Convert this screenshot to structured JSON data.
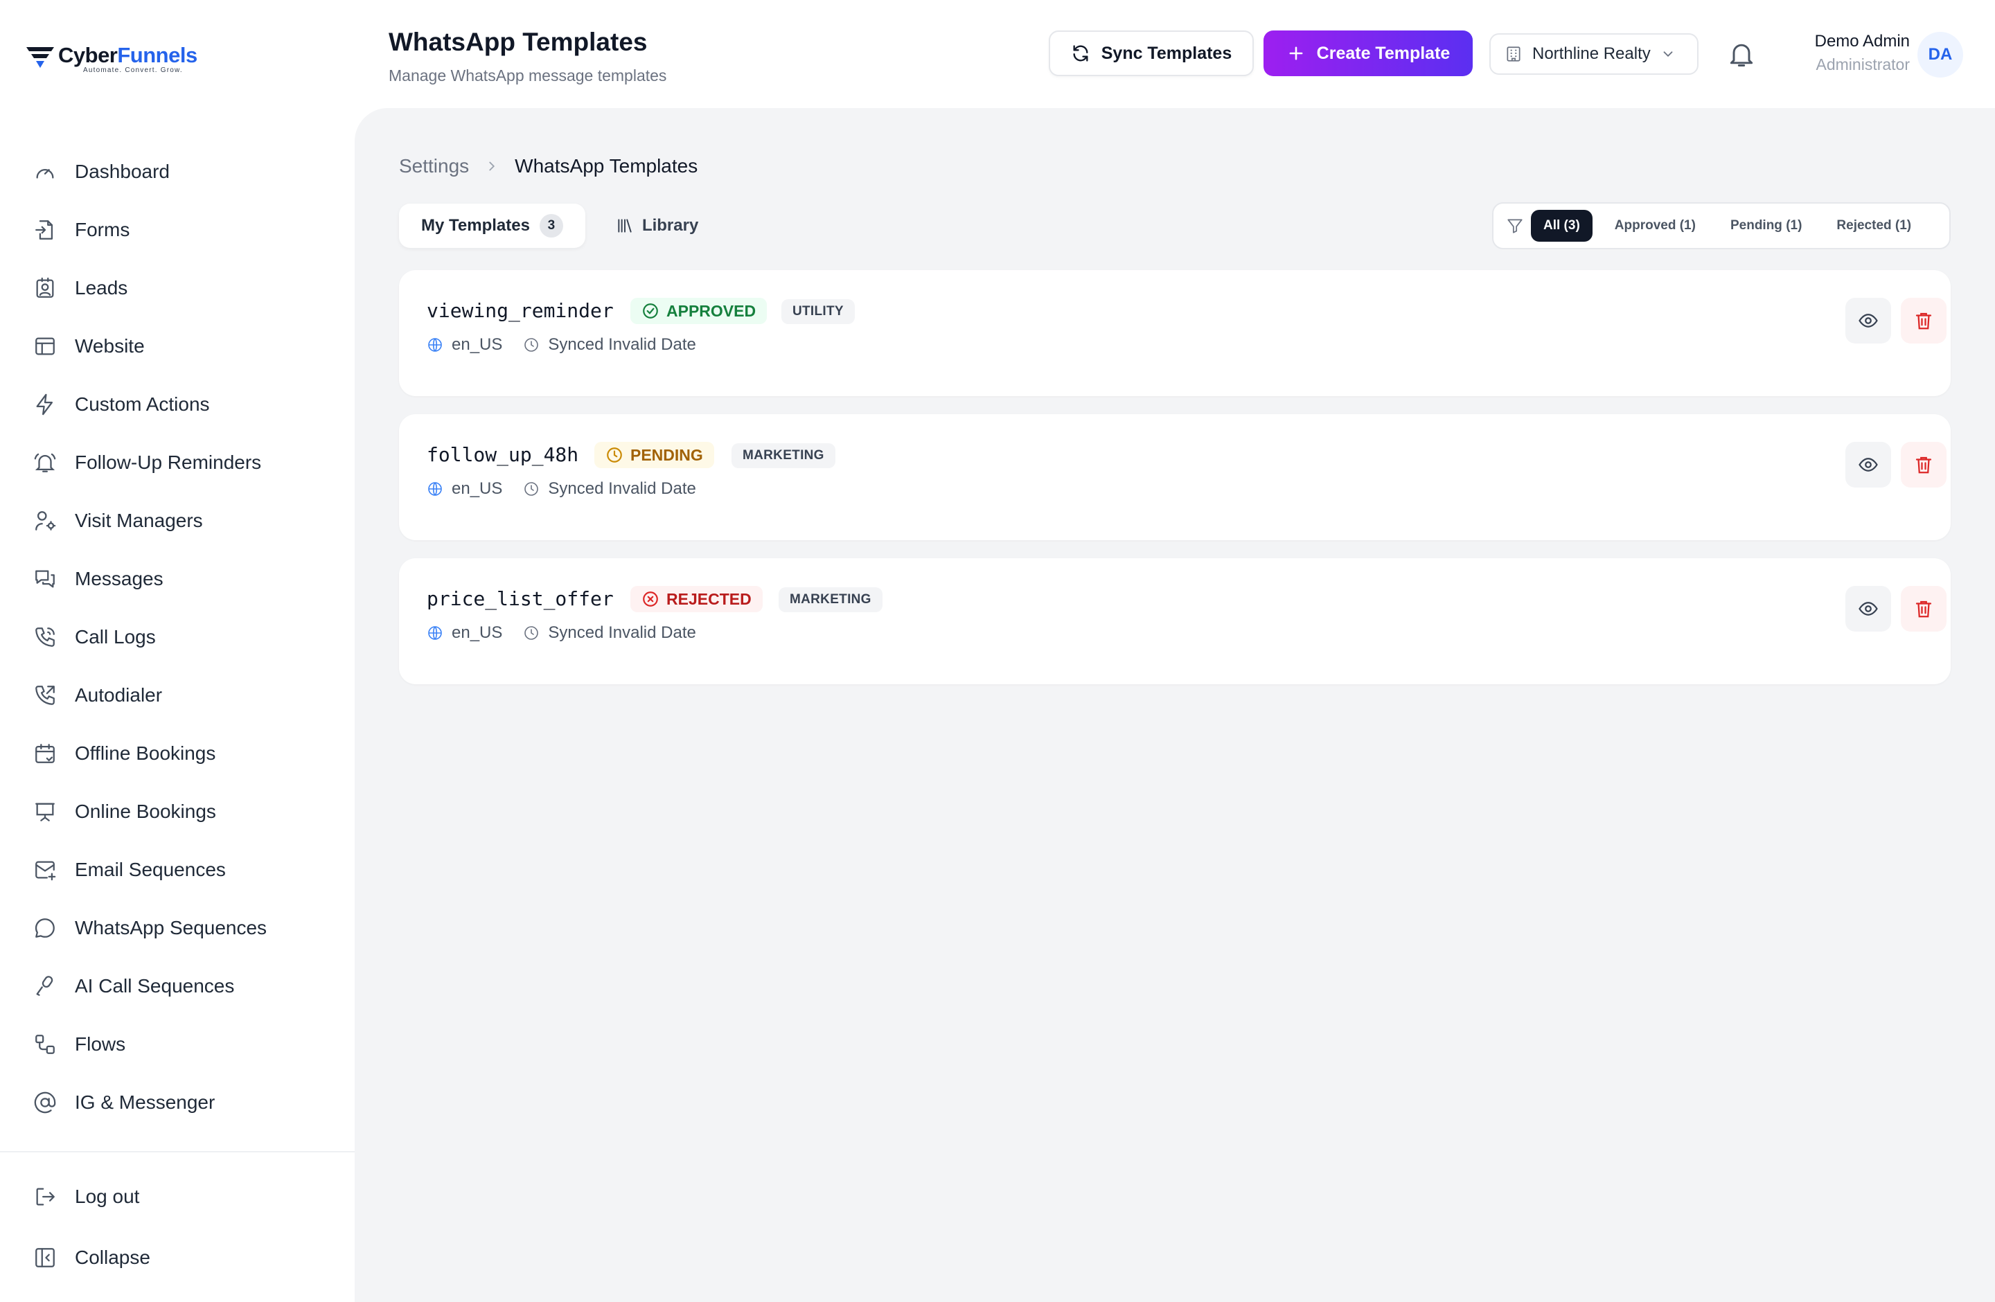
{
  "brand": {
    "name_part1": "Cyber",
    "name_part2": "Funnels",
    "tagline": "Automate. Convert. Grow."
  },
  "sidebar": {
    "items": [
      {
        "label": "Dashboard",
        "icon": "gauge-icon"
      },
      {
        "label": "Forms",
        "icon": "file-import-icon"
      },
      {
        "label": "Leads",
        "icon": "contact-card-icon"
      },
      {
        "label": "Website",
        "icon": "layout-icon"
      },
      {
        "label": "Custom Actions",
        "icon": "zap-icon"
      },
      {
        "label": "Follow-Up Reminders",
        "icon": "bell-ring-icon"
      },
      {
        "label": "Visit Managers",
        "icon": "user-cog-icon"
      },
      {
        "label": "Messages",
        "icon": "messages-icon"
      },
      {
        "label": "Call Logs",
        "icon": "phone-log-icon"
      },
      {
        "label": "Autodialer",
        "icon": "phone-outgoing-icon"
      },
      {
        "label": "Offline Bookings",
        "icon": "calendar-check-icon"
      },
      {
        "label": "Online Bookings",
        "icon": "presentation-icon"
      },
      {
        "label": "Email Sequences",
        "icon": "mail-plus-icon"
      },
      {
        "label": "WhatsApp Sequences",
        "icon": "message-circle-icon"
      },
      {
        "label": "AI Call Sequences",
        "icon": "mic-icon"
      },
      {
        "label": "Flows",
        "icon": "workflow-icon"
      },
      {
        "label": "IG & Messenger",
        "icon": "at-sign-icon"
      }
    ],
    "bottom": [
      {
        "label": "Log out",
        "icon": "log-out-icon"
      },
      {
        "label": "Collapse",
        "icon": "panel-collapse-icon"
      }
    ]
  },
  "header": {
    "title": "WhatsApp Templates",
    "subtitle": "Manage WhatsApp message templates",
    "sync_label": "Sync Templates",
    "create_label": "Create Template",
    "org": "Northline Realty",
    "user_name": "Demo Admin",
    "user_role": "Administrator",
    "avatar_initials": "DA"
  },
  "breadcrumb": {
    "parent": "Settings",
    "current": "WhatsApp Templates"
  },
  "tabs": {
    "my_templates": "My Templates",
    "my_templates_count": "3",
    "library": "Library"
  },
  "filters": {
    "all": "All (3)",
    "approved": "Approved (1)",
    "pending": "Pending (1)",
    "rejected": "Rejected (1)"
  },
  "templates": [
    {
      "name": "viewing_reminder",
      "status": "APPROVED",
      "category": "UTILITY",
      "language": "en_US",
      "synced": "Synced Invalid Date"
    },
    {
      "name": "follow_up_48h",
      "status": "PENDING",
      "category": "MARKETING",
      "language": "en_US",
      "synced": "Synced Invalid Date"
    },
    {
      "name": "price_list_offer",
      "status": "REJECTED",
      "category": "MARKETING",
      "language": "en_US",
      "synced": "Synced Invalid Date"
    }
  ],
  "colors": {
    "accent_start": "#9d1ff0",
    "accent_end": "#5b2ff1",
    "approved": "#15803d",
    "pending": "#a16207",
    "rejected": "#b91c1c",
    "brand_blue": "#2563eb"
  }
}
